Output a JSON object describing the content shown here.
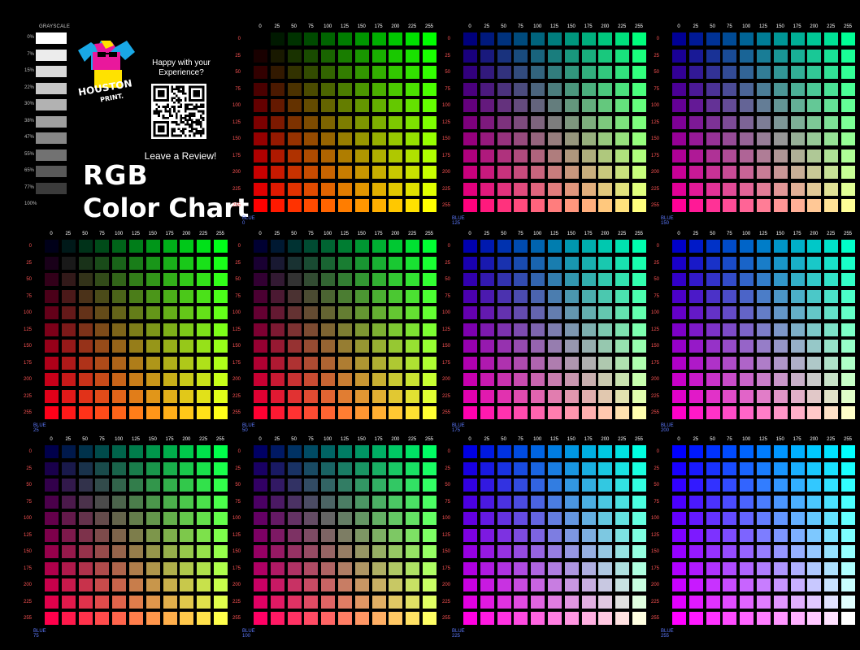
{
  "grayscale": {
    "title": "GRAYSCALE",
    "levels": [
      "0%",
      "7%",
      "15%",
      "22%",
      "30%",
      "38%",
      "47%",
      "55%",
      "65%",
      "77%",
      "100%"
    ],
    "swatch_colors": [
      "#ffffff",
      "#ececec",
      "#d8d8d8",
      "#c6c6c6",
      "#b2b2b2",
      "#9e9e9e",
      "#878787",
      "#727272",
      "#595959",
      "#3b3b3b"
    ]
  },
  "brand": {
    "logo_word1": "HOUSTON",
    "logo_word2": "PRINT.",
    "prompt_line1": "Happy with your",
    "prompt_line2": "Experience?",
    "review_cta": "Leave a Review!"
  },
  "title": {
    "line1": "RGB",
    "line2": "Color Chart"
  },
  "axis_values": [
    0,
    25,
    50,
    75,
    100,
    125,
    150,
    175,
    200,
    225,
    255
  ],
  "charts": [
    {
      "blue": 0,
      "label": "BLUE 0"
    },
    {
      "blue": 125,
      "label": "BLUE 125"
    },
    {
      "blue": 150,
      "label": "BLUE 150"
    },
    {
      "blue": 25,
      "label": "BLUE 25"
    },
    {
      "blue": 50,
      "label": "BLUE 50"
    },
    {
      "blue": 175,
      "label": "BLUE 175"
    },
    {
      "blue": 200,
      "label": "BLUE 200"
    },
    {
      "blue": 75,
      "label": "BLUE 75"
    },
    {
      "blue": 100,
      "label": "BLUE 100"
    },
    {
      "blue": 225,
      "label": "BLUE 225"
    },
    {
      "blue": 255,
      "label": "BLUE 255"
    }
  ]
}
